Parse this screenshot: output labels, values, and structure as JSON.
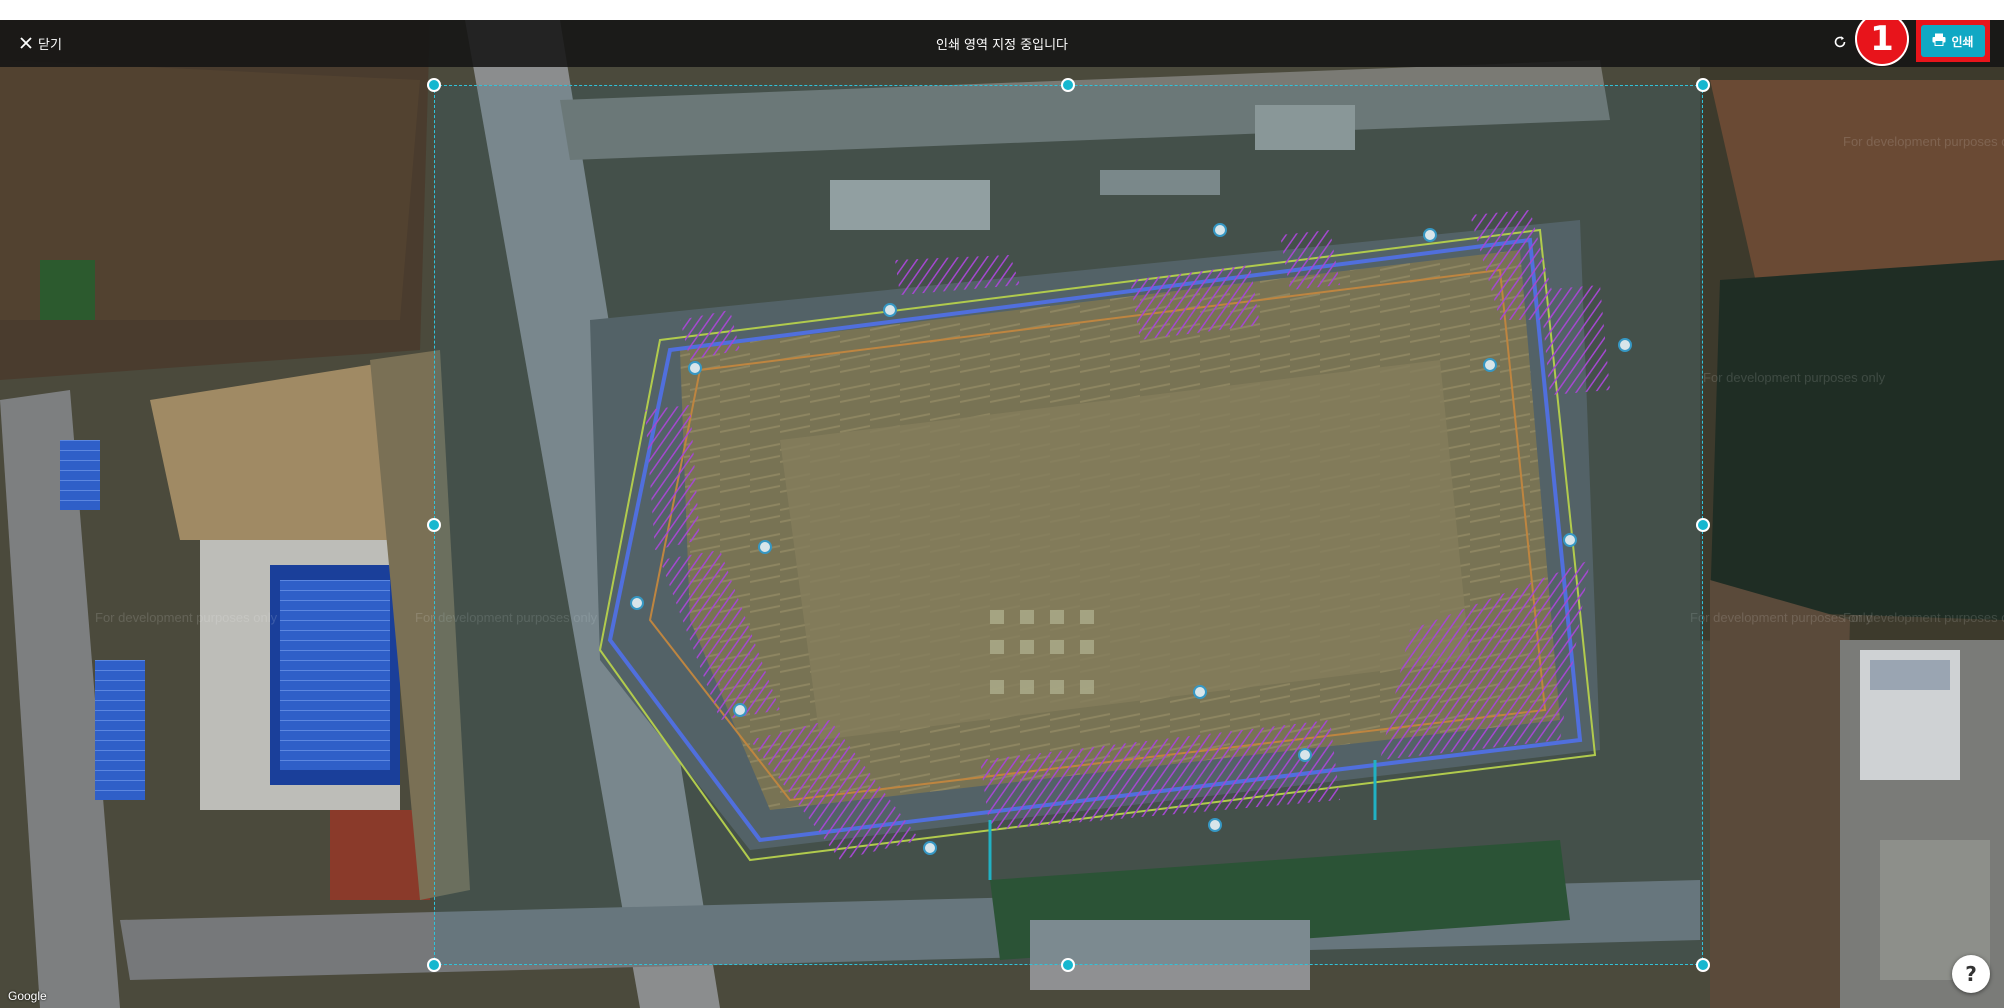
{
  "topbar": {
    "close_label": "닫기",
    "title": "인쇄 영역 지정 중입니다",
    "print_label": "인쇄",
    "step_number": "1"
  },
  "map": {
    "attribution": "Google",
    "watermark": "For development purposes only"
  },
  "help": {
    "label": "?"
  },
  "icons": [
    "close-icon",
    "refresh-icon",
    "printer-icon",
    "help-icon"
  ],
  "colors": {
    "accent": "#10a8c4",
    "highlight": "#e8141b",
    "handle": "#16b7cf"
  }
}
